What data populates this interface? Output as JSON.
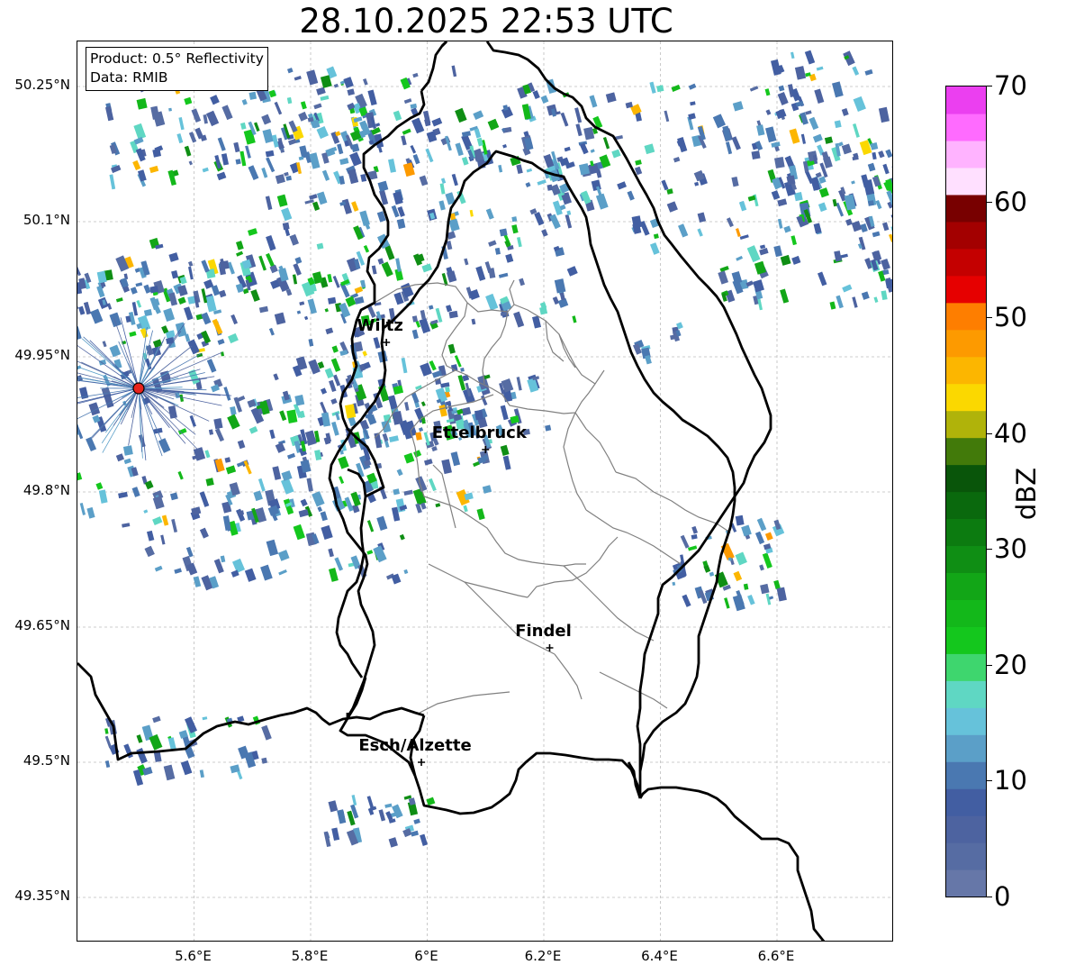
{
  "title": "28.10.2025 22:53 UTC",
  "info": {
    "product": "Product: 0.5° Reflectivity",
    "source": "Data: RMIB"
  },
  "axes": {
    "y_ticks": [
      "50.25°N",
      "50.1°N",
      "49.95°N",
      "49.8°N",
      "49.65°N",
      "49.5°N",
      "49.35°N"
    ],
    "x_ticks": [
      "5.6°E",
      "5.8°E",
      "6°E",
      "6.2°E",
      "6.4°E",
      "6.6°E"
    ]
  },
  "cities": [
    {
      "name": "Wiltz",
      "lon": 5.93,
      "lat": 49.966
    },
    {
      "name": "Ettelbruck",
      "lon": 6.1,
      "lat": 49.847
    },
    {
      "name": "Findel",
      "lon": 6.21,
      "lat": 49.627
    },
    {
      "name": "Esch/Alzette",
      "lon": 5.99,
      "lat": 49.5
    }
  ],
  "radar_site": {
    "lon": 5.505,
    "lat": 49.915,
    "color": "#e8231c"
  },
  "colorbar": {
    "label": "dBZ",
    "ticks": [
      "0",
      "10",
      "20",
      "30",
      "40",
      "50",
      "60",
      "70"
    ],
    "colors": [
      "#6677a8",
      "#566ca3",
      "#4d63a0",
      "#425ea2",
      "#4a78b1",
      "#5b9fc8",
      "#66c2da",
      "#5fd7c3",
      "#3ed66e",
      "#14c71d",
      "#13b81a",
      "#12a617",
      "#0f8e14",
      "#0c7b10",
      "#0a690d",
      "#09550a",
      "#427a0a",
      "#b0b30a",
      "#fbd800",
      "#fcb600",
      "#fd9a00",
      "#fe7e00",
      "#e60000",
      "#c40000",
      "#a30000",
      "#780000",
      "#ffe0ff",
      "#ffb3ff",
      "#ff6bff",
      "#eb3ff0"
    ]
  },
  "colors": {
    "border": "#000000",
    "canton": "#808080",
    "grid": "#bdbdbd"
  }
}
